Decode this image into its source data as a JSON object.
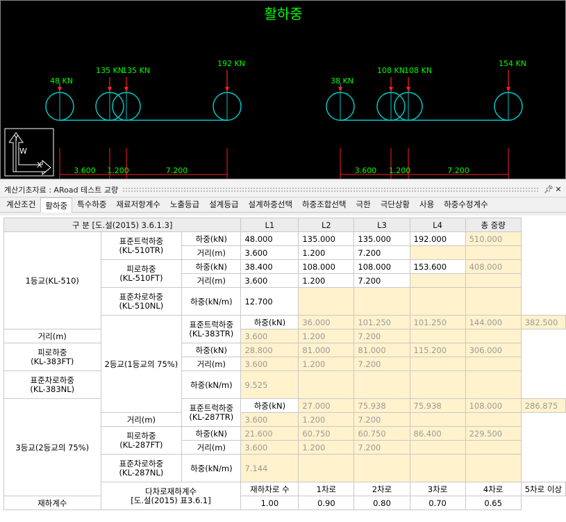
{
  "diagram": {
    "title": "활하중",
    "groups": [
      {
        "loads": [
          "48 KN",
          "135 KN",
          "135 KN",
          "192 KN"
        ],
        "spacings": [
          "3.600",
          "1.200",
          "7.200"
        ]
      },
      {
        "loads": [
          "38 KN",
          "108 KN",
          "108 KN",
          "154 KN"
        ],
        "spacings": [
          "3.600",
          "1.200",
          "7.200"
        ]
      }
    ],
    "axis": {
      "x_label": "X",
      "y_label": "Y",
      "w_label": "W"
    },
    "colors": {
      "background": "#000000",
      "wheel": "#00c8c8",
      "load_arrow": "#ff2020",
      "text": "#00ff00",
      "dim": "#ff2020"
    }
  },
  "panel": {
    "title": "계산기초자료 : ARoad 테스트 교량",
    "pin_icon": "pin-icon",
    "close_icon": "close-icon"
  },
  "tabs": [
    "계산조건",
    "활하중",
    "특수하중",
    "재료저항계수",
    "노출등급",
    "설계등급",
    "설계하중선택",
    "하중조합선택",
    "극한",
    "극단상황",
    "사용",
    "하중수정계수"
  ],
  "active_tab": "활하중",
  "table": {
    "header": {
      "division": "구 분 [도.설(2015) 3.6.1.3]",
      "l1": "L1",
      "l2": "L2",
      "l3": "L3",
      "l4": "L4",
      "total": "총 중량"
    },
    "grades": [
      {
        "name": "1등교(KL-510)",
        "truck": {
          "name": "표준트럭하중",
          "code": "(KL-510TR)",
          "load_label": "하중(kN)",
          "dist_label": "거리(m)",
          "loads": [
            "48.000",
            "135.000",
            "135.000",
            "192.000"
          ],
          "total": "510.000",
          "dists": [
            "3.600",
            "1.200",
            "7.200"
          ]
        },
        "fatigue": {
          "name": "피로하중",
          "code": "(KL-510FT)",
          "load_label": "하중(kN)",
          "dist_label": "거리(m)",
          "loads": [
            "38.400",
            "108.000",
            "108.000",
            "153.600"
          ],
          "total": "408.000",
          "dists": [
            "3.600",
            "1.200",
            "7.200"
          ]
        },
        "lane": {
          "name": "표준차로하중",
          "code": "(KL-510NL)",
          "label": "하중(kN/m)",
          "value": "12.700"
        }
      },
      {
        "name": "2등교(1등교의 75%)",
        "truck": {
          "name": "표준트럭하중",
          "code": "(KL-383TR)",
          "load_label": "하중(kN)",
          "dist_label": "거리(m)",
          "loads": [
            "36.000",
            "101.250",
            "101.250",
            "144.000"
          ],
          "total": "382.500",
          "dists": [
            "3.600",
            "1.200",
            "7.200"
          ]
        },
        "fatigue": {
          "name": "피로하중",
          "code": "(KL-383FT)",
          "load_label": "하중(kN)",
          "dist_label": "거리(m)",
          "loads": [
            "28.800",
            "81.000",
            "81.000",
            "115.200"
          ],
          "total": "306.000",
          "dists": [
            "3.600",
            "1.200",
            "7.200"
          ]
        },
        "lane": {
          "name": "표준차로하중",
          "code": "(KL-383NL)",
          "label": "하중(kN/m)",
          "value": "9.525"
        }
      },
      {
        "name": "3등교(2등교의 75%)",
        "truck": {
          "name": "표준트럭하중",
          "code": "(KL-287TR)",
          "load_label": "하중(kN)",
          "dist_label": "거리(m)",
          "loads": [
            "27.000",
            "75.938",
            "75.938",
            "108.000"
          ],
          "total": "286.875",
          "dists": [
            "3.600",
            "1.200",
            "7.200"
          ]
        },
        "fatigue": {
          "name": "피로하중",
          "code": "(KL-287FT)",
          "load_label": "하중(kN)",
          "dist_label": "거리(m)",
          "loads": [
            "21.600",
            "60.750",
            "60.750",
            "86.400"
          ],
          "total": "229.500",
          "dists": [
            "3.600",
            "1.200",
            "7.200"
          ]
        },
        "lane": {
          "name": "표준차로하중",
          "code": "(KL-287NL)",
          "label": "하중(kN/m)",
          "value": "7.144"
        }
      }
    ],
    "multilane": {
      "name": "다차로재하계수",
      "ref": "[도.설(2015) 표3.6.1]",
      "lanes_label": "재하차로 수",
      "factor_label": "재하계수",
      "lanes": [
        "1차로",
        "2차로",
        "3차로",
        "4차로",
        "5차로 이상"
      ],
      "factors": [
        "1.00",
        "0.90",
        "0.80",
        "0.70",
        "0.65"
      ]
    }
  }
}
